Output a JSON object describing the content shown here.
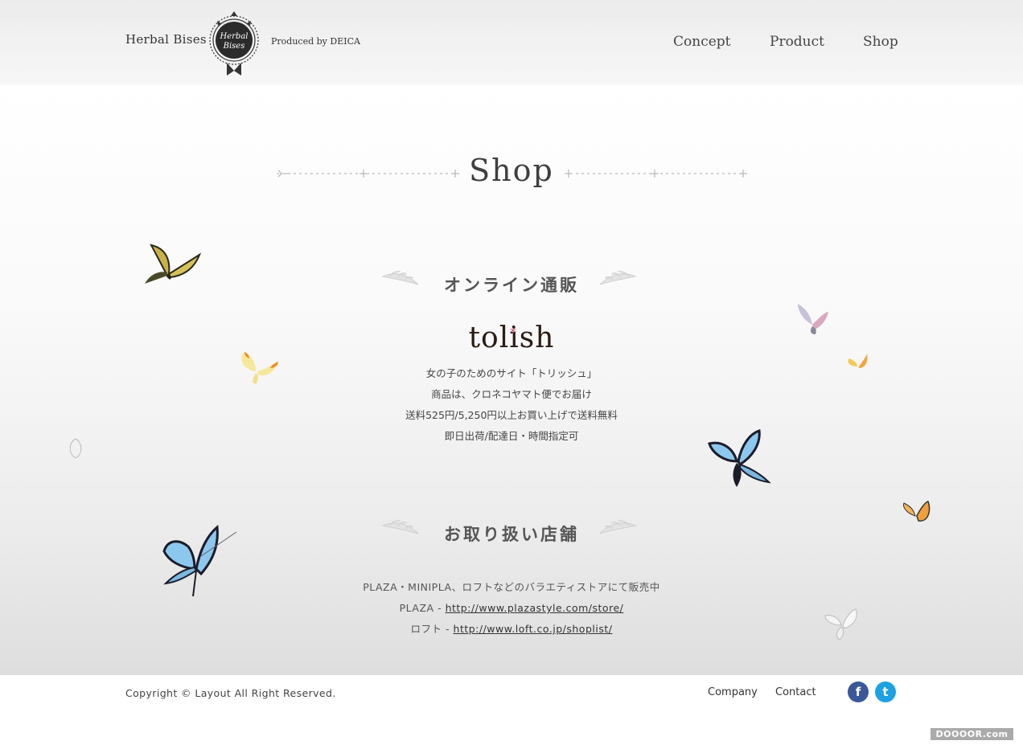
{
  "header": {
    "brand_name": "Herbal Bises",
    "emblem_text_line1": "Herbal",
    "emblem_text_line2": "Bises",
    "produced_by": "Produced by DEICA",
    "nav": [
      "Concept",
      "Product",
      "Shop"
    ]
  },
  "main": {
    "page_title": "Shop",
    "online": {
      "heading": "オンライン通販",
      "logo_text": "tolish",
      "lines": [
        "女の子のためのサイト「トリッシュ」",
        "商品は、クロネコヤマト便でお届け",
        "送料525円/5,250円以上お買い上げで送料無料",
        "即日出荷/配達日・時間指定可"
      ]
    },
    "stores": {
      "heading": "お取り扱い店舗",
      "intro": "PLAZA・MINIPLA、ロフトなどのバラエティストアにて販売中",
      "items": [
        {
          "name": "PLAZA",
          "separator": " - ",
          "url": "http://www.plazastyle.com/store/"
        },
        {
          "name": "ロフト",
          "separator": " - ",
          "url": "http://www.loft.co.jp/shoplist/"
        }
      ]
    }
  },
  "footer": {
    "copyright": "Copyright © Layout All Right Reserved.",
    "links": [
      "Company",
      "Contact"
    ],
    "social": {
      "facebook": "f",
      "twitter": "t"
    },
    "watermark": "DOOOOR.com"
  },
  "colors": {
    "facebook": "#3b5998",
    "twitter": "#1da1e2",
    "tolish_star": "#c8505a",
    "butterfly_blue": "#8cc8ee"
  }
}
